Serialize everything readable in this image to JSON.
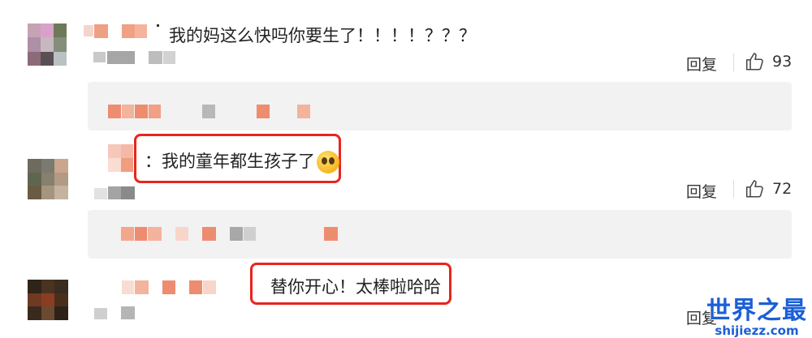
{
  "comments": [
    {
      "text": "我的妈这么快吗你要生了！！！！？？？",
      "reply_label": "回复",
      "likes": "93"
    },
    {
      "text": "我的童年都生孩子了",
      "emoji": "pleading-face-emoji",
      "reply_label": "回复",
      "likes": "72"
    },
    {
      "text": "替你开心！太棒啦哈哈",
      "reply_label": "回复"
    }
  ],
  "watermark": {
    "main": "世界之最",
    "sub": "shijiezz.com"
  },
  "colors": {
    "highlight_border": "#e8251c",
    "reply_box_bg": "#f2f2f2",
    "watermark": "#1a5fd6"
  },
  "icons": [
    "thumbs-up-icon"
  ]
}
